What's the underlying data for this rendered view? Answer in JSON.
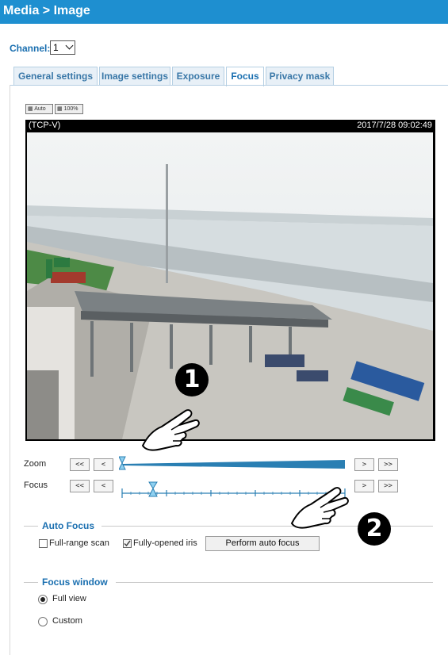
{
  "header": {
    "title": "Media  > Image"
  },
  "channel": {
    "label": "Channel:",
    "value": "1"
  },
  "tabs": [
    {
      "label": "General settings"
    },
    {
      "label": "Image settings"
    },
    {
      "label": "Exposure"
    },
    {
      "label": "Focus"
    },
    {
      "label": "Privacy mask"
    }
  ],
  "active_tab": "Focus",
  "view_buttons": {
    "auto": "Auto",
    "full": "100%"
  },
  "video": {
    "stream": "(TCP-V)",
    "timestamp": "2017/7/28 09:02:49"
  },
  "zoom": {
    "label": "Zoom",
    "btn_fast_back": "<<",
    "btn_back": "<",
    "btn_forward": ">",
    "btn_fast_forward": ">>",
    "level": 0
  },
  "focus": {
    "label": "Focus",
    "btn_fast_back": "<<",
    "btn_back": "<",
    "btn_forward": ">",
    "btn_fast_forward": ">>",
    "level": 0.12
  },
  "auto_focus": {
    "title": "Auto Focus",
    "full_range_label": "Full-range scan",
    "full_range_checked": false,
    "iris_label": "Fully-opened iris",
    "iris_checked": true,
    "perform_button": "Perform auto focus"
  },
  "focus_window": {
    "title": "Focus window",
    "options": [
      {
        "label": "Full view",
        "selected": true
      },
      {
        "label": "Custom",
        "selected": false
      }
    ]
  },
  "annotations": {
    "marker1": "1",
    "marker2": "2"
  },
  "colors": {
    "header": "#1e8fd0",
    "accent": "#1a6fb0",
    "slider": "#2a7fb3"
  }
}
